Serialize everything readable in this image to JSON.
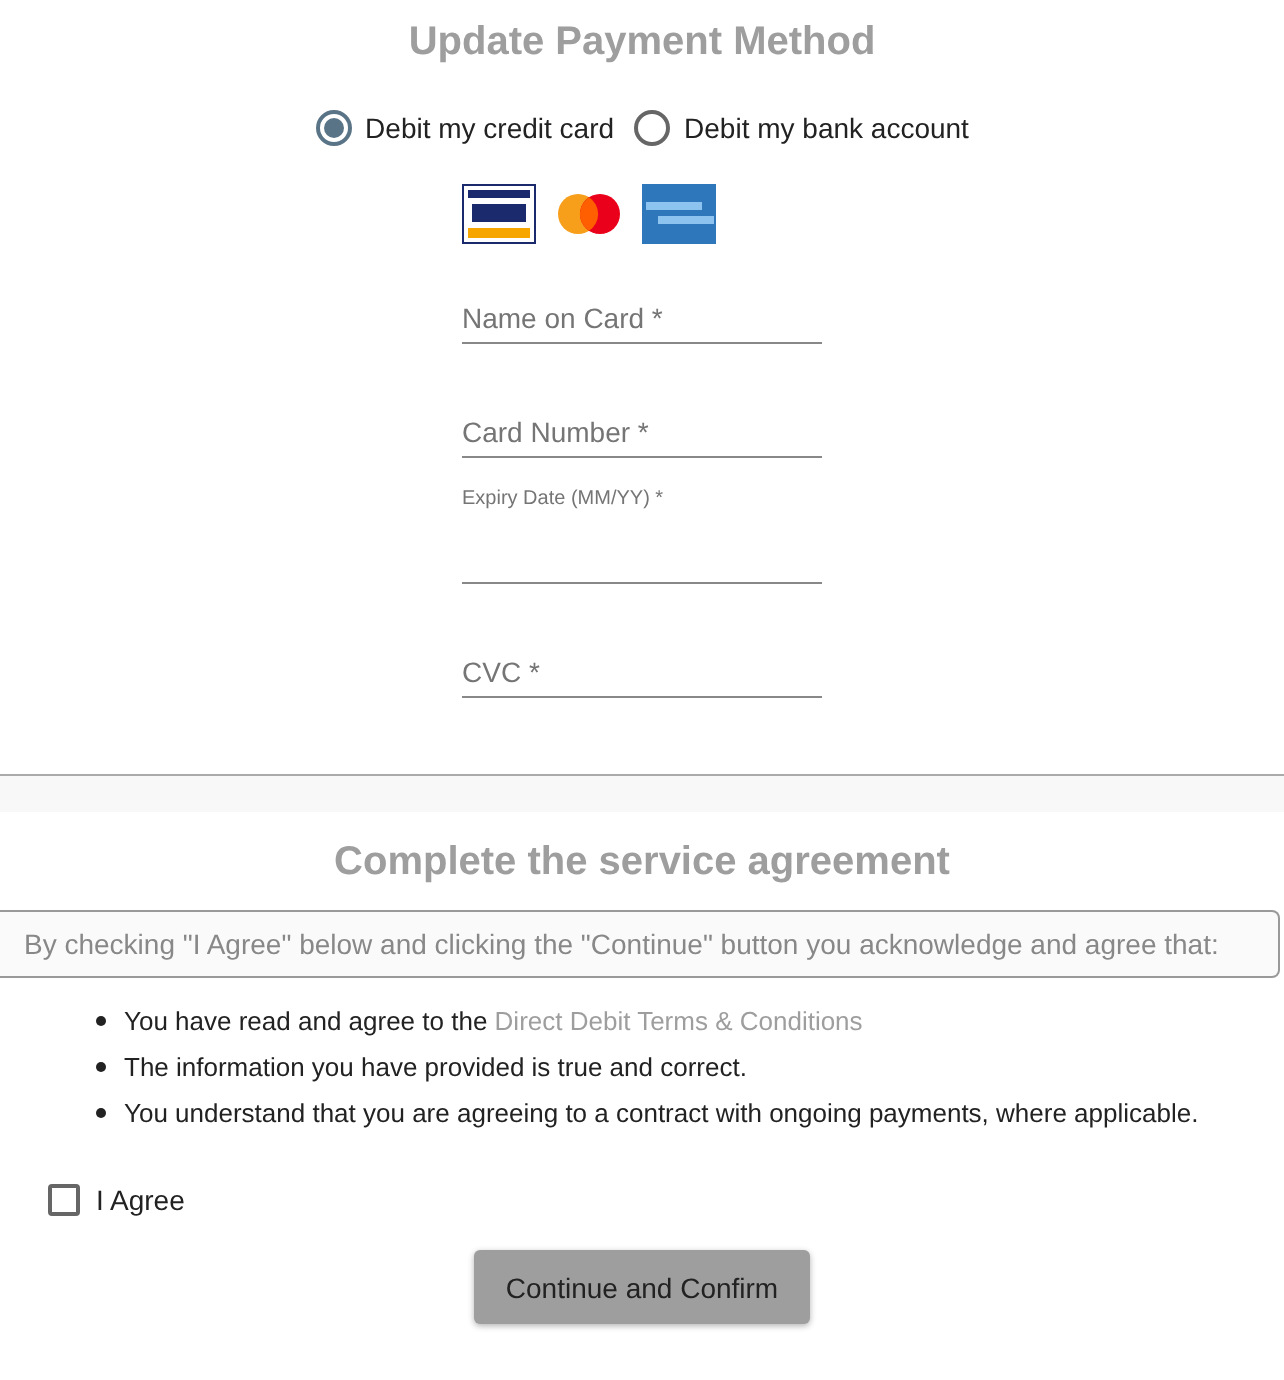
{
  "title": "Update Payment Method",
  "payment_options": [
    {
      "label": "Debit my credit card",
      "selected": true
    },
    {
      "label": "Debit my bank account",
      "selected": false
    }
  ],
  "card_logos": [
    {
      "kind": "visa"
    },
    {
      "kind": "mastercard"
    },
    {
      "kind": "amex"
    }
  ],
  "fields": [
    {
      "kind": "placeholder",
      "placeholder": "Name on Card *"
    },
    {
      "kind": "placeholder",
      "placeholder": "Card Number *"
    },
    {
      "kind": "label",
      "label": "Expiry Date (MM/YY) *"
    },
    {
      "kind": "placeholder",
      "placeholder": "CVC *"
    }
  ],
  "agreement": {
    "title": "Complete the service agreement",
    "notice": "By checking \"I Agree\" below and clicking the \"Continue\" button you acknowledge and agree that:",
    "points": [
      {
        "text": "You have read and agree to the",
        "link": "Direct Debit Terms & Conditions"
      },
      {
        "text": "The information you have provided is true and correct."
      },
      {
        "text": "You understand that you are agreeing to a contract with ongoing payments, where applicable."
      }
    ],
    "checkbox": {
      "label": "I Agree",
      "checked": false
    },
    "button": "Continue and Confirm"
  }
}
